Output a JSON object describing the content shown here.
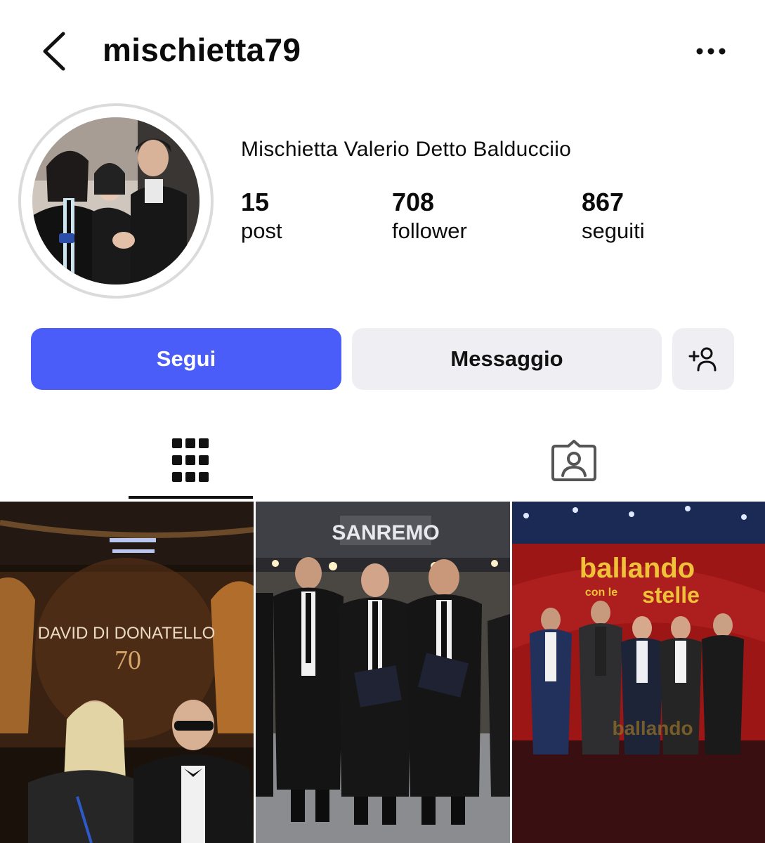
{
  "header": {
    "username": "mischietta79",
    "back_icon": "chevron-left-icon",
    "more_icon": "more-horizontal-icon"
  },
  "profile": {
    "full_name": "Mischietta Valerio Detto Balducciio",
    "avatar": "profile-photo",
    "stats": {
      "posts": {
        "count": "15",
        "label": "post"
      },
      "followers": {
        "count": "708",
        "label": "follower"
      },
      "following": {
        "count": "867",
        "label": "seguiti"
      }
    }
  },
  "actions": {
    "follow_label": "Segui",
    "message_label": "Messaggio",
    "add_user_icon": "add-person-icon"
  },
  "tabs": [
    {
      "name": "posts-grid",
      "icon": "grid-icon",
      "selected": true
    },
    {
      "name": "tagged",
      "icon": "tagged-person-icon",
      "selected": false
    }
  ],
  "posts": [
    {
      "overlay_title": "DAVID DI DONATELLO",
      "overlay_number": "70"
    },
    {
      "overlay_title": "SANREMO"
    },
    {
      "overlay_title": "ballando",
      "overlay_sub1": "con le",
      "overlay_sub2": "stelle"
    }
  ],
  "colors": {
    "accent": "#4a5df9",
    "secondary_button": "#efeff3",
    "text": "#0b0b0b"
  }
}
